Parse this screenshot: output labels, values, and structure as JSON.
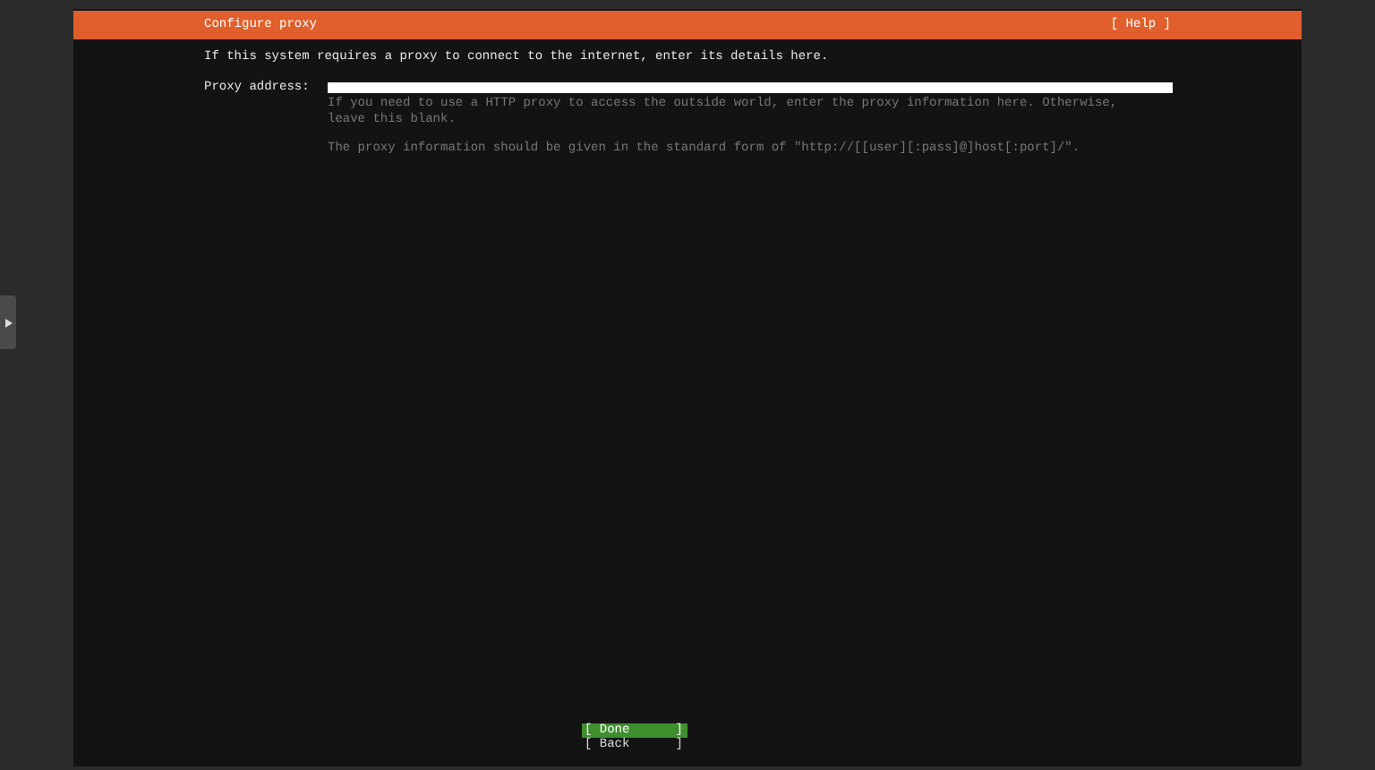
{
  "header": {
    "title": "Configure proxy",
    "help": "[ Help ]"
  },
  "intro": "If this system requires a proxy to connect to the internet, enter its details here.",
  "proxy_field": {
    "label": "Proxy address:"
  },
  "help_texts": [
    "If you need to use a HTTP proxy to access the outside world, enter the proxy information here. Otherwise, leave this blank.",
    "The proxy information should be given in the standard form of \"http://[[user][:pass]@]host[:port]/\"."
  ],
  "buttons": [
    {
      "open": "[",
      "label": "Done",
      "close": "]",
      "selected": true
    },
    {
      "open": "[",
      "label": "Back",
      "close": "]",
      "selected": false
    }
  ]
}
